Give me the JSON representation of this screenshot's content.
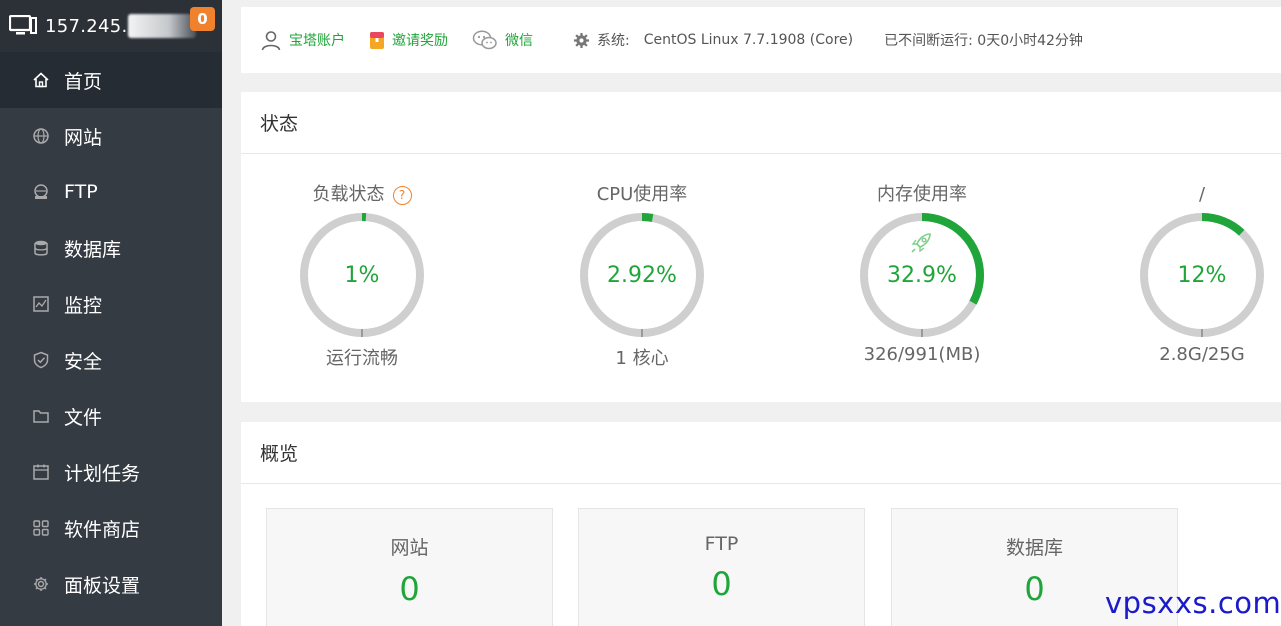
{
  "sidebar": {
    "ip": "157.245.",
    "badge": "0",
    "items": [
      {
        "label": "首页",
        "icon": "home-icon"
      },
      {
        "label": "网站",
        "icon": "globe-icon"
      },
      {
        "label": "FTP",
        "icon": "ftp-icon"
      },
      {
        "label": "数据库",
        "icon": "database-icon"
      },
      {
        "label": "监控",
        "icon": "monitor-chart-icon"
      },
      {
        "label": "安全",
        "icon": "shield-icon"
      },
      {
        "label": "文件",
        "icon": "folder-icon"
      },
      {
        "label": "计划任务",
        "icon": "calendar-icon"
      },
      {
        "label": "软件商店",
        "icon": "apps-grid-icon"
      },
      {
        "label": "面板设置",
        "icon": "gear-icon"
      }
    ]
  },
  "topbar": {
    "account": "宝塔账户",
    "invite": "邀请奖励",
    "wechat": "微信",
    "system_label": "系统:",
    "system_value": "CentOS Linux 7.7.1908 (Core)",
    "uptime": "已不间断运行: 0天0小时42分钟"
  },
  "status": {
    "title": "状态",
    "gauges": [
      {
        "title": "负载状态",
        "value": "1%",
        "percent": 1,
        "sub": "运行流畅"
      },
      {
        "title": "CPU使用率",
        "value": "2.92%",
        "percent": 2.92,
        "sub": "1 核心"
      },
      {
        "title": "内存使用率",
        "value": "32.9%",
        "percent": 32.9,
        "sub": "326/991(MB)"
      },
      {
        "title": "/",
        "value": "12%",
        "percent": 12,
        "sub": "2.8G/25G"
      }
    ]
  },
  "overview": {
    "title": "概览",
    "cards": [
      {
        "title": "网站",
        "value": "0"
      },
      {
        "title": "FTP",
        "value": "0"
      },
      {
        "title": "数据库",
        "value": "0"
      }
    ]
  },
  "watermark": "vpsxxs.com",
  "colors": {
    "accent": "#20a53a",
    "sidebar": "#343b43",
    "badge": "#f0822d"
  }
}
